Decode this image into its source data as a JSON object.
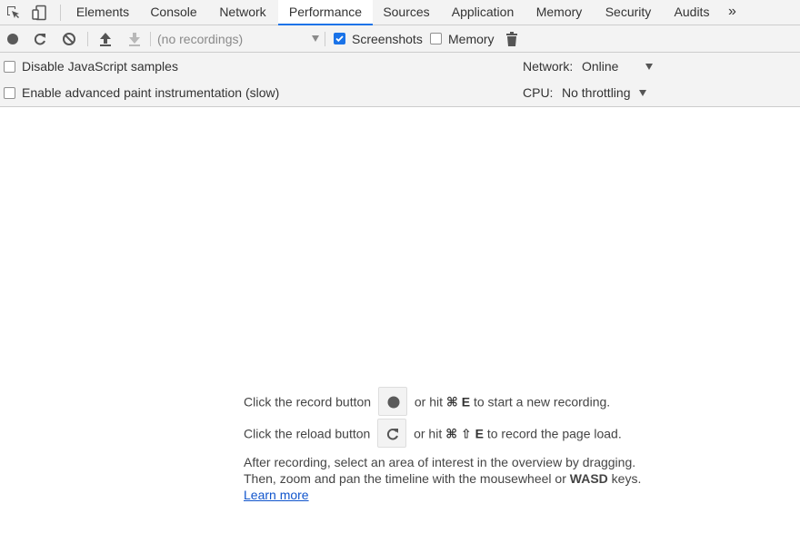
{
  "tabs": [
    {
      "label": "Elements"
    },
    {
      "label": "Console"
    },
    {
      "label": "Network"
    },
    {
      "label": "Performance",
      "active": true
    },
    {
      "label": "Sources"
    },
    {
      "label": "Application"
    },
    {
      "label": "Memory"
    },
    {
      "label": "Security"
    },
    {
      "label": "Audits"
    }
  ],
  "tab_more_label": "»",
  "toolbar": {
    "recordings_placeholder": "(no recordings)",
    "screenshots_label": "Screenshots",
    "screenshots_checked": true,
    "memory_label": "Memory",
    "memory_checked": false
  },
  "settings": {
    "disable_js_samples_label": "Disable JavaScript samples",
    "advanced_paint_label": "Enable advanced paint instrumentation (slow)",
    "network_label": "Network:",
    "network_value": "Online",
    "cpu_label": "CPU:",
    "cpu_value": "No throttling"
  },
  "landing": {
    "record_pre": "Click the record button",
    "record_post_pre": "or hit",
    "record_keys": "⌘ E",
    "record_post": "to start a new recording.",
    "reload_pre": "Click the reload button",
    "reload_post_pre": "or hit",
    "reload_keys": "⌘ ⇧ E",
    "reload_post": "to record the page load.",
    "para_line1": "After recording, select an area of interest in the overview by dragging.",
    "para_line2_pre": "Then, zoom and pan the timeline with the mousewheel or",
    "para_line2_keys": "WASD",
    "para_line2_post": "keys.",
    "learn_more": "Learn more"
  },
  "colors": {
    "accent": "#1a73e8",
    "link": "#1155cc",
    "toolbar_bg": "#f3f3f3"
  }
}
